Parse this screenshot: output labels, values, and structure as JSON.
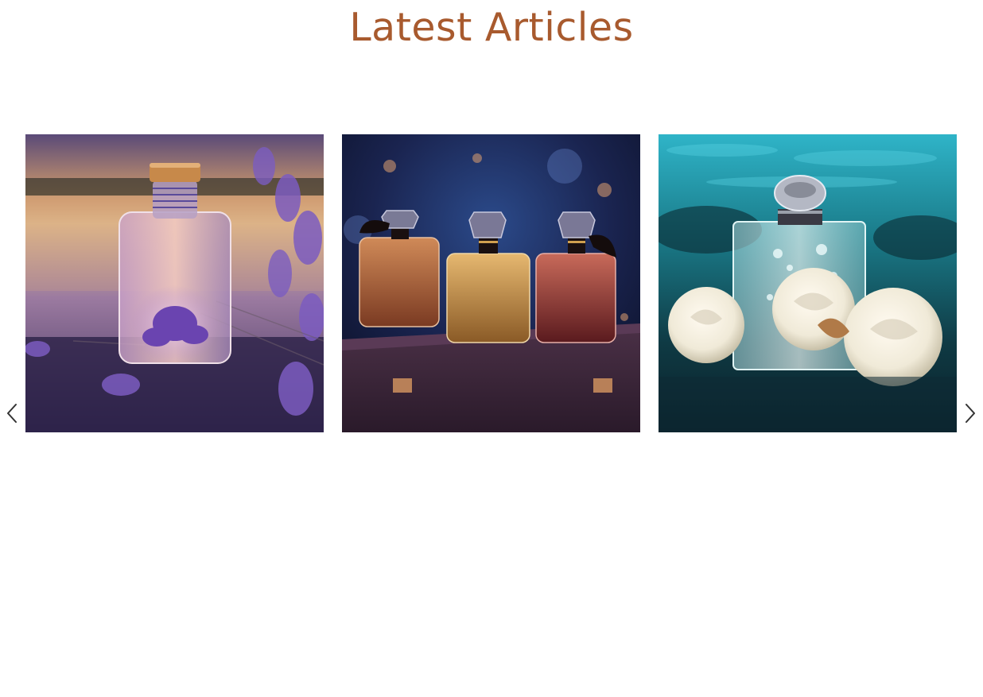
{
  "section": {
    "title": "Latest Articles"
  },
  "carousel": {
    "prev_icon": "chevron-left-icon",
    "next_icon": "chevron-right-icon",
    "articles": [
      {
        "image_subject": "lavender-perfume-bottle-at-lakeside-sunset"
      },
      {
        "image_subject": "three-perfume-bottles-on-purple-pedestal"
      },
      {
        "image_subject": "perfume-bottle-with-white-roses-in-water"
      }
    ]
  },
  "colors": {
    "title": "#a85a2e",
    "arrow": "#333333",
    "background": "#ffffff"
  }
}
